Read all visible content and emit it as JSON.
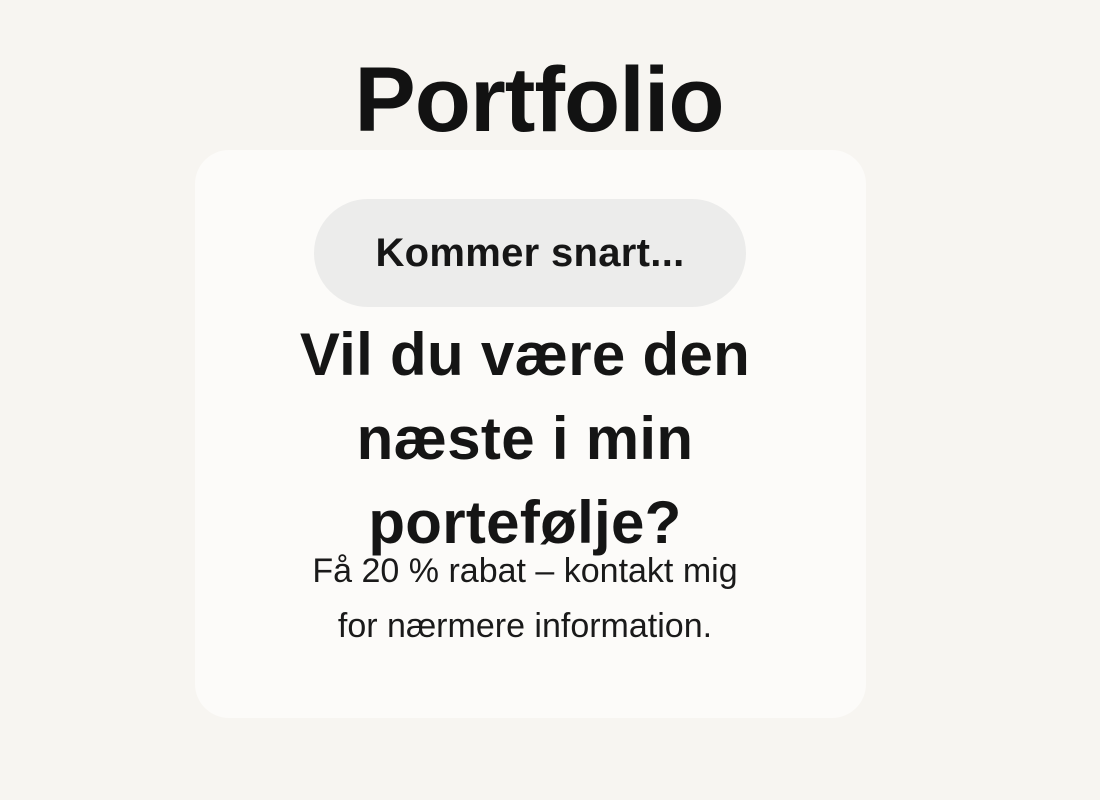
{
  "page": {
    "title": "Portfolio"
  },
  "card": {
    "badge_label": "Kommer snart...",
    "headline": "Vil du være den næste i min portefølje?",
    "body_line1": "Få 20 % rabat – kontakt mig",
    "body_line2": "for nærmere information."
  },
  "colors": {
    "background": "#f7f5f1",
    "card": "#fcfbf9",
    "badge": "#ececeb",
    "text": "#141414"
  }
}
